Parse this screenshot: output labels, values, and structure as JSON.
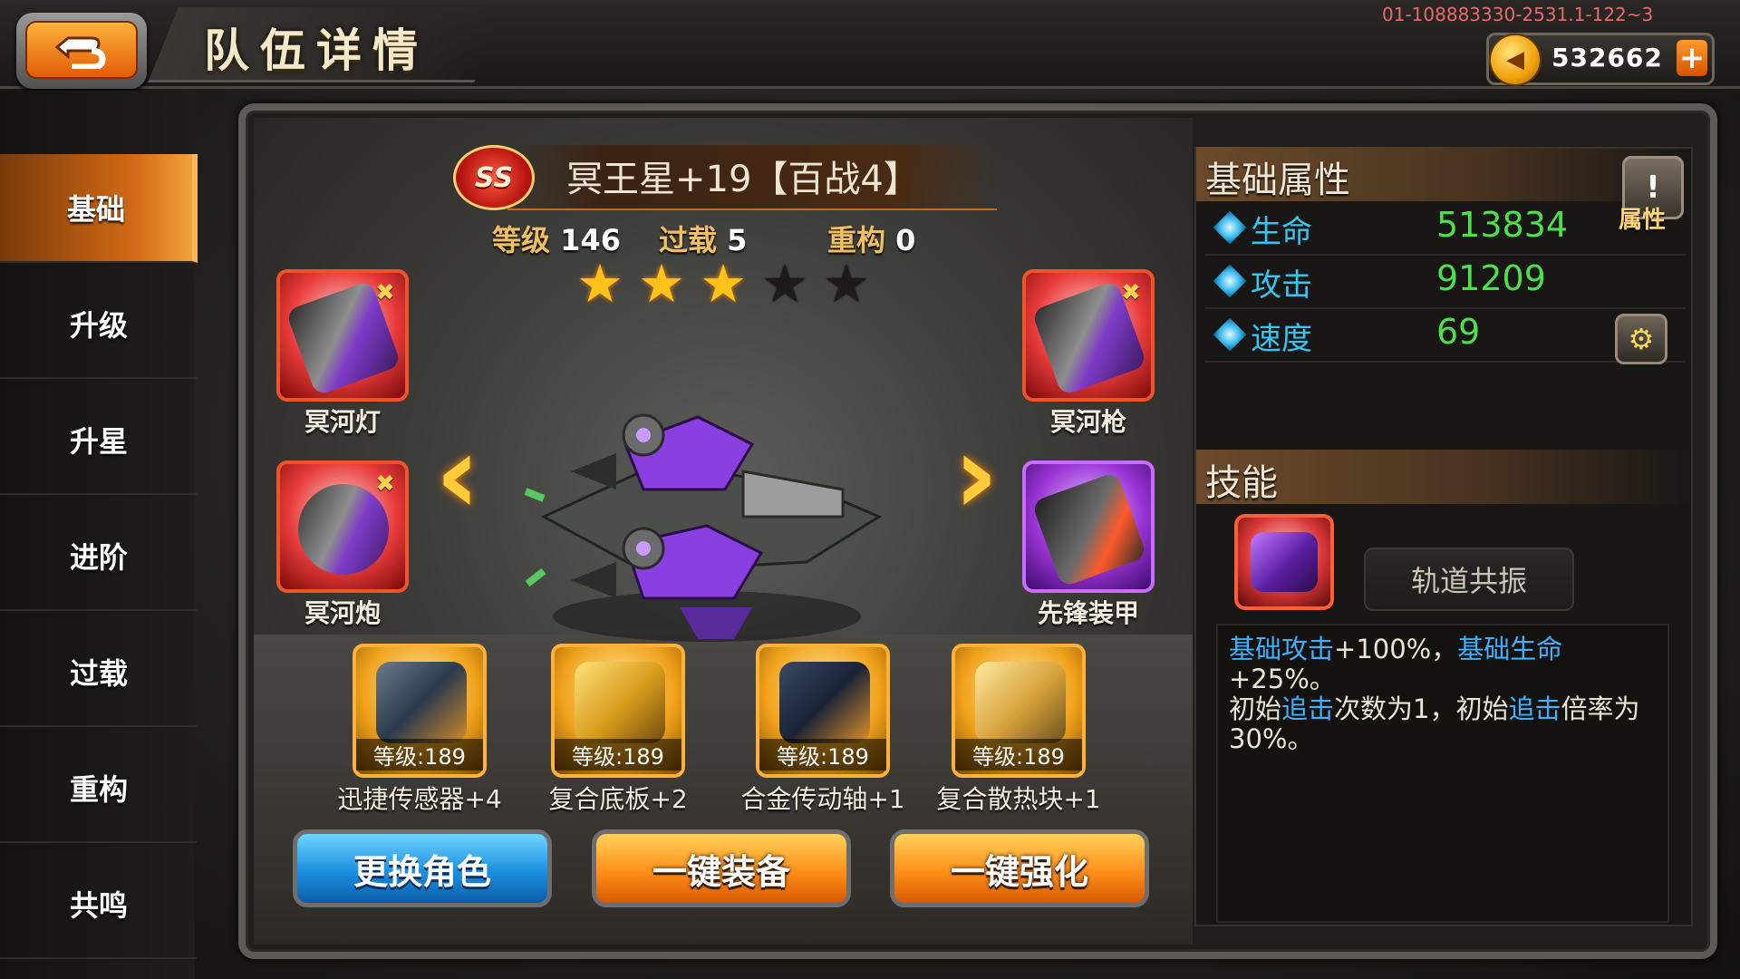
{
  "header": {
    "title": "队伍详情",
    "server_id": "01-108883330-2531.1-122~3",
    "coins": "532662",
    "add_label": "+",
    "back_icon": "return-arrow-icon"
  },
  "sidebar": {
    "items": [
      {
        "label": "基础",
        "active": true
      },
      {
        "label": "升级"
      },
      {
        "label": "升星"
      },
      {
        "label": "进阶"
      },
      {
        "label": "过载"
      },
      {
        "label": "重构"
      },
      {
        "label": "共鸣"
      }
    ]
  },
  "unit": {
    "rank": "SS",
    "name": "冥王星+19【百战4】",
    "level_label": "等级",
    "level": "146",
    "overload_label": "过载",
    "overload": "5",
    "rebuild_label": "重构",
    "rebuild": "0",
    "stars_total": 5,
    "stars_filled": 3
  },
  "slots": {
    "top_left": {
      "name": "冥河灯"
    },
    "bottom_left": {
      "name": "冥河炮"
    },
    "top_right": {
      "name": "冥河枪"
    },
    "bottom_right": {
      "name": "先锋装甲"
    }
  },
  "equipment": [
    {
      "level": "等级:189",
      "name": "迅捷传感器+4"
    },
    {
      "level": "等级:189",
      "name": "复合底板+2"
    },
    {
      "level": "等级:189",
      "name": "合金传动轴+1"
    },
    {
      "level": "等级:189",
      "name": "复合散热块+1"
    }
  ],
  "buttons": {
    "change_role": "更换角色",
    "equip_all": "一键装备",
    "strengthen_all": "一键强化"
  },
  "attributes": {
    "title": "基础属性",
    "info_label": "属性",
    "hp_label": "生命",
    "hp": "513834",
    "atk_label": "攻击",
    "atk": "91209",
    "spd_label": "速度",
    "spd": "69"
  },
  "skill": {
    "title": "技能",
    "name": "轨道共振",
    "desc_parts": {
      "p1": "基础攻击",
      "p2": "+100%，",
      "p3": "基础生命",
      "p4": "+25%。",
      "p5": "初始",
      "p6": "追击",
      "p7": "次数为1，初始",
      "p8": "追击",
      "p9": "倍率为",
      "p10": "30%。"
    }
  },
  "colors": {
    "accent_orange": "#ff8f1a",
    "attr_name": "#34c6f0",
    "attr_value": "#4ee04a",
    "highlight": "#3db0ff"
  }
}
